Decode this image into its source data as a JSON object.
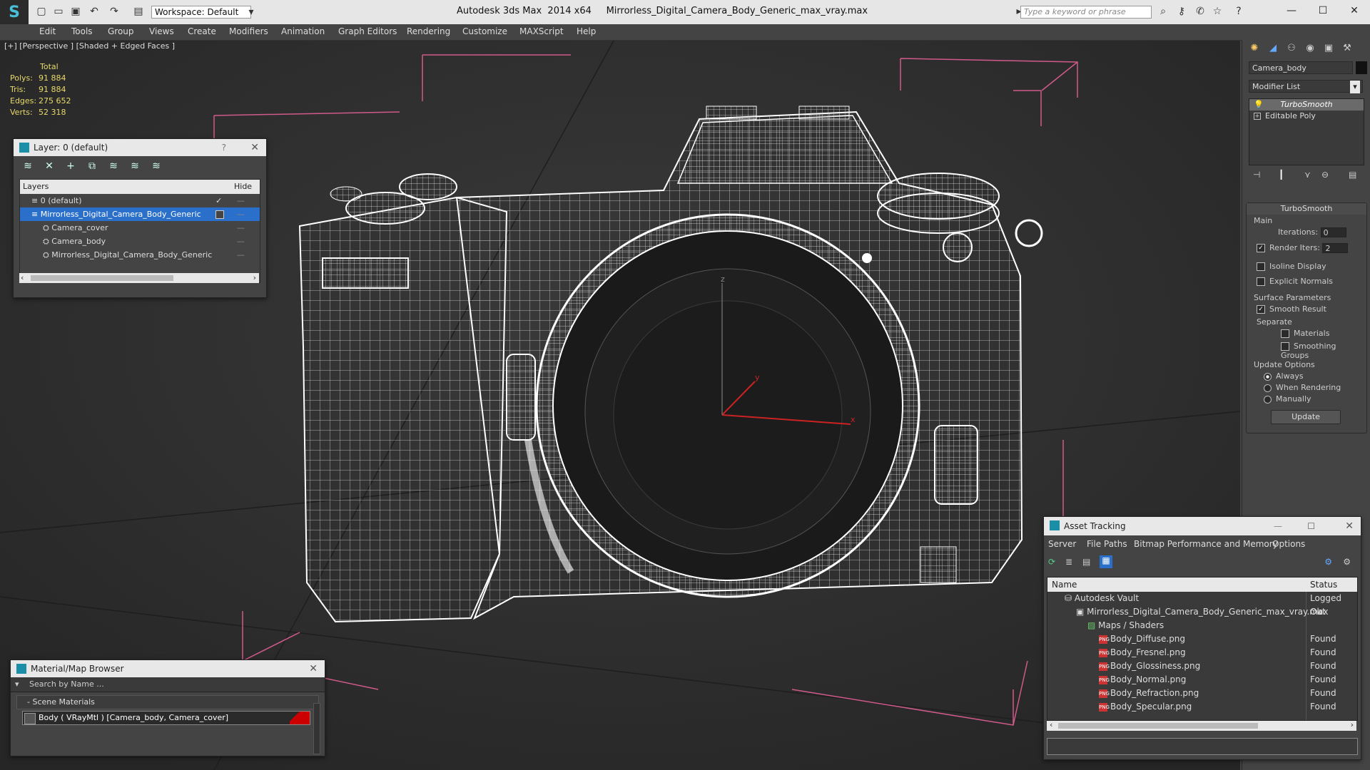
{
  "titlebar": {
    "workspace": "Workspace: Default",
    "app_name": "Autodesk 3ds Max  2014 x64",
    "file_name": "Mirrorless_Digital_Camera_Body_Generic_max_vray.max",
    "search_placeholder": "Type a keyword or phrase"
  },
  "menu": [
    "Edit",
    "Tools",
    "Group",
    "Views",
    "Create",
    "Modifiers",
    "Animation",
    "Graph Editors",
    "Rendering",
    "Customize",
    "MAXScript",
    "Help"
  ],
  "viewport": {
    "label": "[+] [Perspective ] [Shaded + Edged Faces ]",
    "stats": {
      "header": "Total",
      "polys_label": "Polys:",
      "polys": "91 884",
      "tris_label": "Tris:",
      "tris": "91 884",
      "edges_label": "Edges:",
      "edges": "275 652",
      "verts_label": "Verts:",
      "verts": "52 318"
    },
    "axis": {
      "x": "x",
      "y": "y",
      "z": "z"
    }
  },
  "layer_dialog": {
    "title": "Layer: 0 (default)",
    "help": "?",
    "columns": {
      "layers": "Layers",
      "hide": "Hide"
    },
    "rows": [
      {
        "name": "0 (default)",
        "selected": false
      },
      {
        "name": "Mirrorless_Digital_Camera_Body_Generic",
        "selected": true
      },
      {
        "name": "Camera_cover",
        "selected": false
      },
      {
        "name": "Camera_body",
        "selected": false
      },
      {
        "name": "Mirrorless_Digital_Camera_Body_Generic",
        "selected": false
      }
    ]
  },
  "material_browser": {
    "title": "Material/Map Browser",
    "search_placeholder": "Search by Name ...",
    "section": "- Scene Materials",
    "material": "Body  ( VRayMtl ) [Camera_body, Camera_cover]"
  },
  "command_panel": {
    "object_name": "Camera_body",
    "modifier_list": "Modifier List",
    "stack": [
      "TurboSmooth",
      "Editable Poly"
    ],
    "turbosmooth": {
      "title": "TurboSmooth",
      "main": "Main",
      "iterations_label": "Iterations:",
      "iterations": "0",
      "render_iters_label": "Render Iters:",
      "render_iters": "2",
      "isoline": "Isoline Display",
      "explicit_normals": "Explicit Normals",
      "surface_params": "Surface Parameters",
      "smooth_result": "Smooth Result",
      "separate": "Separate",
      "materials": "Materials",
      "smoothing_groups": "Smoothing Groups",
      "update_options": "Update Options",
      "always": "Always",
      "when_rendering": "When Rendering",
      "manually": "Manually",
      "update_button": "Update"
    }
  },
  "asset_tracking": {
    "title": "Asset Tracking",
    "menu": [
      "Server",
      "File",
      "Paths",
      "Bitmap Performance and Memory",
      "Options"
    ],
    "columns": {
      "name": "Name",
      "status": "Status"
    },
    "rows": [
      {
        "name": "Autodesk Vault",
        "status": "Logged Out"
      },
      {
        "name": "Mirrorless_Digital_Camera_Body_Generic_max_vray.max",
        "status": "Ok"
      },
      {
        "name": "Maps / Shaders",
        "status": ""
      },
      {
        "name": "Body_Diffuse.png",
        "status": "Found"
      },
      {
        "name": "Body_Fresnel.png",
        "status": "Found"
      },
      {
        "name": "Body_Glossiness.png",
        "status": "Found"
      },
      {
        "name": "Body_Normal.png",
        "status": "Found"
      },
      {
        "name": "Body_Refraction.png",
        "status": "Found"
      },
      {
        "name": "Body_Specular.png",
        "status": "Found"
      }
    ]
  },
  "colors": {
    "selection": "#2a6fc9",
    "stats": "#e8d96a",
    "bbox": "#d05a8a",
    "wire": "#ffffff"
  }
}
